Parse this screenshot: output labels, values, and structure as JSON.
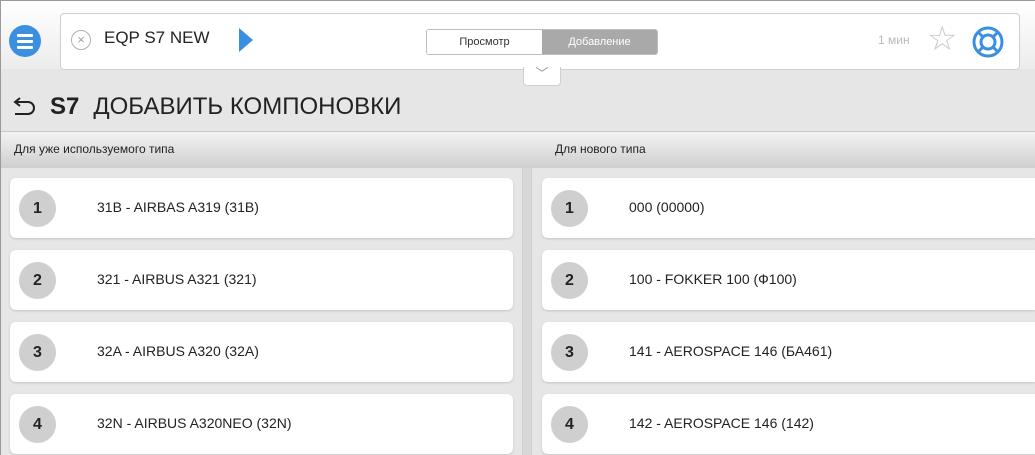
{
  "header": {
    "tab_title": "EQP S7 NEW",
    "view_label": "Просмотр",
    "add_label": "Добавление",
    "time_label": "1 мин"
  },
  "page": {
    "code": "S7",
    "title": "ДОБАВИТЬ КОМПОНОВКИ"
  },
  "left": {
    "heading": "Для уже используемого типа",
    "items": [
      {
        "num": "1",
        "label": "31B - AIRBAS A319 (31B)"
      },
      {
        "num": "2",
        "label": "321 - AIRBUS A321 (321)"
      },
      {
        "num": "3",
        "label": "32A - AIRBUS A320 (32A)"
      },
      {
        "num": "4",
        "label": "32N - AIRBUS A320NEO (32N)"
      }
    ]
  },
  "right": {
    "heading": "Для нового типа",
    "items": [
      {
        "num": "1",
        "label": "000 (00000)"
      },
      {
        "num": "2",
        "label": "100 - FOKKER 100 (Ф100)"
      },
      {
        "num": "3",
        "label": "141 - AEROSPACE 146 (БА461)"
      },
      {
        "num": "4",
        "label": "142 - AEROSPACE 146 (142)"
      }
    ]
  },
  "icons": {
    "menu": "hamburger-icon",
    "close": "close-icon",
    "forward": "play-arrow-icon",
    "favorite": "star-icon",
    "help": "lifebuoy-icon",
    "expand": "chevron-down-icon",
    "back": "back-arrow-icon"
  },
  "colors": {
    "accent": "#3a8fe0",
    "active_segment": "#a9a9a9",
    "badge": "#cfcfcf"
  }
}
